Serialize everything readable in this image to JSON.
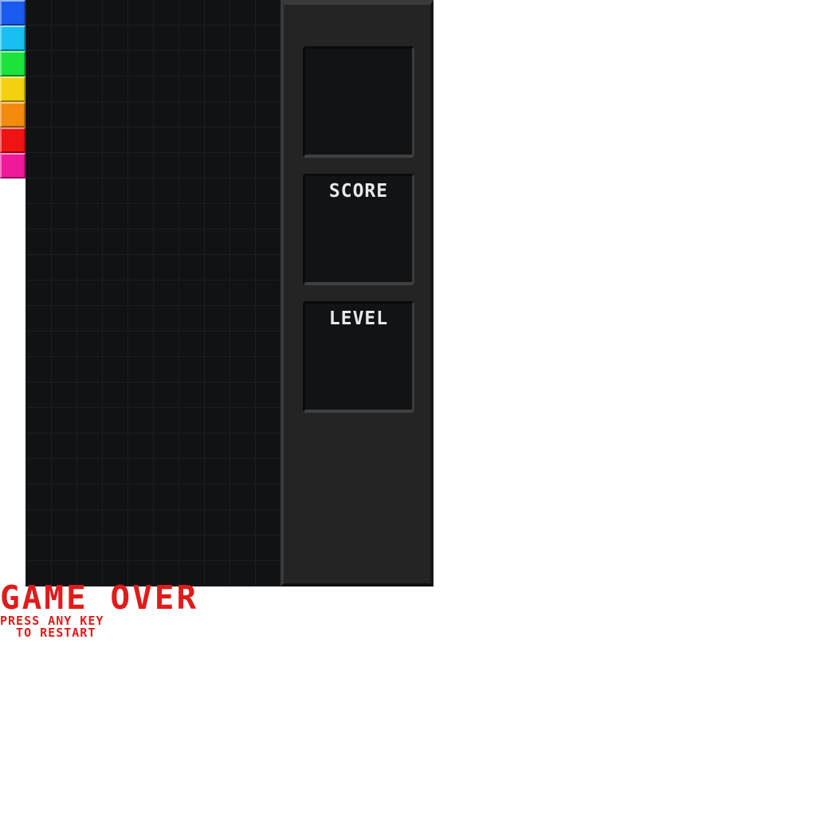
{
  "palette": {
    "colors": [
      "#1a5cf0",
      "#18bff0",
      "#1ce23a",
      "#f2d20e",
      "#f28a0e",
      "#ef1313",
      "#f0199a"
    ]
  },
  "panel": {
    "next_label": "",
    "score_label": "SCORE",
    "score_value": "",
    "level_label": "LEVEL",
    "level_value": ""
  },
  "overlay": {
    "game_over": "GAME OVER",
    "restart_line1": "PRESS ANY KEY",
    "restart_line2": "  TO RESTART"
  }
}
